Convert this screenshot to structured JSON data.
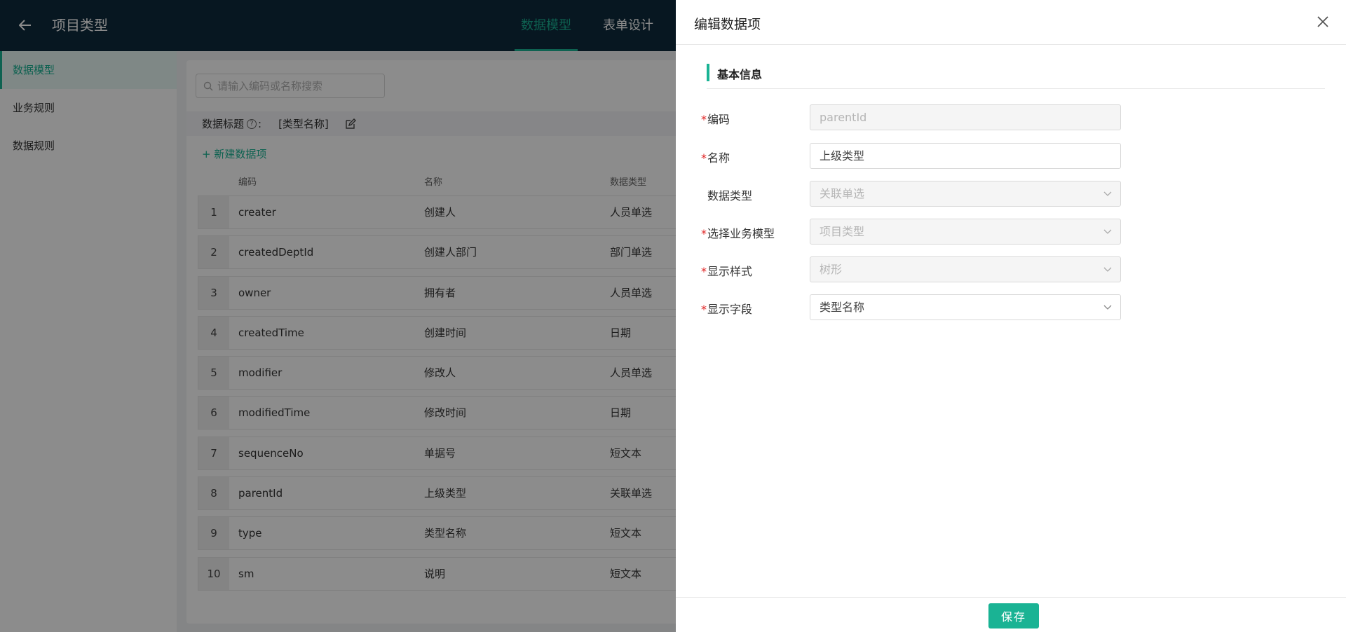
{
  "header": {
    "title": "项目类型",
    "tabs": [
      {
        "label": "数据模型",
        "active": true
      },
      {
        "label": "表单设计",
        "active": false
      }
    ]
  },
  "sidebar": {
    "items": [
      {
        "label": "数据模型",
        "active": true
      },
      {
        "label": "业务规则",
        "active": false
      },
      {
        "label": "数据规则",
        "active": false
      }
    ]
  },
  "main": {
    "search_placeholder": "请输入编码或名称搜索",
    "data_title_label": "数据标题",
    "data_title_colon": ":",
    "data_title_value": "[类型名称]",
    "new_item_label": "+ 新建数据项",
    "columns": [
      "编码",
      "名称",
      "数据类型"
    ],
    "rows": [
      {
        "index": "1",
        "code": "creater",
        "name": "创建人",
        "type": "人员单选"
      },
      {
        "index": "2",
        "code": "createdDeptId",
        "name": "创建人部门",
        "type": "部门单选"
      },
      {
        "index": "3",
        "code": "owner",
        "name": "拥有者",
        "type": "人员单选"
      },
      {
        "index": "4",
        "code": "createdTime",
        "name": "创建时间",
        "type": "日期"
      },
      {
        "index": "5",
        "code": "modifier",
        "name": "修改人",
        "type": "人员单选"
      },
      {
        "index": "6",
        "code": "modifiedTime",
        "name": "修改时间",
        "type": "日期"
      },
      {
        "index": "7",
        "code": "sequenceNo",
        "name": "单据号",
        "type": "短文本"
      },
      {
        "index": "8",
        "code": "parentId",
        "name": "上级类型",
        "type": "关联单选"
      },
      {
        "index": "9",
        "code": "type",
        "name": "类型名称",
        "type": "短文本"
      },
      {
        "index": "10",
        "code": "sm",
        "name": "说明",
        "type": "短文本"
      }
    ]
  },
  "drawer": {
    "title": "编辑数据项",
    "section_title": "基本信息",
    "fields": [
      {
        "label": "编码",
        "required": "*",
        "value": "parentId",
        "disabled": true,
        "select": false
      },
      {
        "label": "名称",
        "required": "*",
        "value": "上级类型",
        "disabled": false,
        "select": false
      },
      {
        "label": "数据类型",
        "required": "",
        "value": "关联单选",
        "disabled": true,
        "select": true
      },
      {
        "label": "选择业务模型",
        "required": "*",
        "value": "项目类型",
        "disabled": true,
        "select": true
      },
      {
        "label": "显示样式",
        "required": "*",
        "value": "树形",
        "disabled": true,
        "select": true
      },
      {
        "label": "显示字段",
        "required": "*",
        "value": "类型名称",
        "disabled": false,
        "select": true
      }
    ],
    "save_label": "保存"
  },
  "colors": {
    "accent": "#1ab394",
    "header_bg": "#0e2a3c",
    "required": "#e02424"
  }
}
